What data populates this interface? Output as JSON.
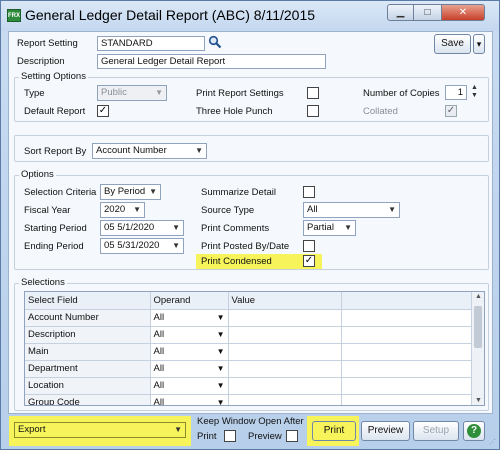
{
  "window": {
    "app_icon_text": "FRX",
    "title": "General Ledger Detail Report (ABC) 8/11/2015",
    "minimize_glyph": "▁",
    "maximize_glyph": "□",
    "close_glyph": "✕"
  },
  "header": {
    "report_setting_label": "Report Setting",
    "report_setting_value": "STANDARD",
    "description_label": "Description",
    "description_value": "General Ledger Detail Report",
    "save_label": "Save",
    "save_menu_glyph": "▾",
    "lookup_icon": "magnifier-icon"
  },
  "setting_options": {
    "title": "Setting Options",
    "type_label": "Type",
    "type_value": "Public",
    "default_report_label": "Default Report",
    "default_report_checked": true,
    "print_report_settings_label": "Print Report Settings",
    "print_report_settings_checked": false,
    "three_hole_punch_label": "Three Hole Punch",
    "three_hole_punch_checked": false,
    "number_of_copies_label": "Number of Copies",
    "number_of_copies_value": "1",
    "collated_label": "Collated",
    "collated_checked": true
  },
  "sort": {
    "label": "Sort Report By",
    "value": "Account Number"
  },
  "options": {
    "title": "Options",
    "selection_criteria_label": "Selection Criteria",
    "selection_criteria_value": "By Period",
    "fiscal_year_label": "Fiscal Year",
    "fiscal_year_value": "2020",
    "starting_period_label": "Starting Period",
    "starting_period_value": "05 5/1/2020",
    "ending_period_label": "Ending Period",
    "ending_period_value": "05 5/31/2020",
    "summarize_detail_label": "Summarize Detail",
    "summarize_detail_checked": false,
    "source_type_label": "Source Type",
    "source_type_value": "All",
    "print_comments_label": "Print Comments",
    "print_comments_value": "Partial",
    "print_posted_by_label": "Print Posted By/Date",
    "print_posted_by_checked": false,
    "print_condensed_label": "Print Condensed",
    "print_condensed_checked": true
  },
  "selections": {
    "title": "Selections",
    "columns": [
      "Select Field",
      "Operand",
      "Value"
    ],
    "rows": [
      {
        "field": "Account Number",
        "operand": "All",
        "value": ""
      },
      {
        "field": "Description",
        "operand": "All",
        "value": ""
      },
      {
        "field": "Main",
        "operand": "All",
        "value": ""
      },
      {
        "field": "Department",
        "operand": "All",
        "value": ""
      },
      {
        "field": "Location",
        "operand": "All",
        "value": ""
      },
      {
        "field": "Group Code",
        "operand": "All",
        "value": ""
      }
    ]
  },
  "footer": {
    "output_value": "Export",
    "keep_open_label": "Keep Window Open After",
    "print_label": "Print",
    "print_checked": false,
    "preview_label": "Preview",
    "preview_checked": false,
    "print_button": "Print",
    "preview_button": "Preview",
    "setup_button": "Setup",
    "help_icon": "help-icon"
  },
  "colors": {
    "highlight": "#f6f45a",
    "titlebar": "#c3d7ef",
    "close_button": "#c7402a"
  }
}
